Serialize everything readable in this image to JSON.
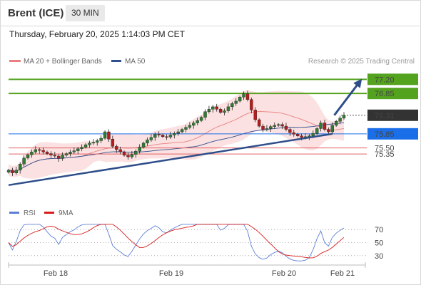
{
  "header": {
    "instrument": "Brent (ICE)",
    "timeframe": "30 MIN"
  },
  "datetime": "Thursday, February 20, 2025 1:14:03 PM CET",
  "colors": {
    "up": "#2e7d32",
    "down": "#b71c1c",
    "resistance": "#54a31f",
    "current": "#333333",
    "pivot": "#1a6ee8",
    "support": "#e06060",
    "band": "#f8c8c8",
    "ma20": "#e98080",
    "ma50": "#2f4f8f",
    "trend": "#2e4e8a",
    "rsi": "#5c7fd6",
    "rsi_ma": "#d91c1c"
  },
  "chart_data": [
    {
      "type": "candlestick",
      "title": "Brent (ICE)",
      "timeframe": "30 MIN",
      "legend": [
        {
          "name": "MA 20 + Bollinger Bands",
          "color": "#e98080"
        },
        {
          "name": "MA 50",
          "color": "#2f4f8f"
        }
      ],
      "source": "Research © 2025 Trading Central",
      "x_ticks": [
        "Feb 18",
        "Feb 19",
        "Feb 20",
        "Feb 21"
      ],
      "ylim": [
        74.4,
        77.4
      ],
      "levels": [
        {
          "value": 77.2,
          "label": "77.20",
          "kind": "resistance"
        },
        {
          "value": 76.85,
          "label": "76.85",
          "kind": "resistance"
        },
        {
          "value": 76.31,
          "label": "76.31",
          "kind": "current"
        },
        {
          "value": 75.85,
          "label": "75.85",
          "kind": "pivot"
        },
        {
          "value": 75.5,
          "label": "75.50",
          "kind": "support"
        },
        {
          "value": 75.35,
          "label": "75.35",
          "kind": "support"
        }
      ],
      "trendline": {
        "from": [
          0,
          74.58
        ],
        "to": [
          84,
          75.85
        ]
      },
      "forecast_arrow": {
        "from": [
          84.5,
          76.31
        ],
        "to": [
          91,
          77.13
        ]
      },
      "closes": [
        74.95,
        74.88,
        74.95,
        75.1,
        75.25,
        75.33,
        75.4,
        75.46,
        75.44,
        75.4,
        75.36,
        75.32,
        75.3,
        75.24,
        75.32,
        75.36,
        75.4,
        75.43,
        75.48,
        75.52,
        75.58,
        75.62,
        75.64,
        75.68,
        75.74,
        75.9,
        75.72,
        75.54,
        75.46,
        75.4,
        75.32,
        75.28,
        75.34,
        75.42,
        75.52,
        75.62,
        75.7,
        75.76,
        75.84,
        75.82,
        75.78,
        75.77,
        75.82,
        75.86,
        75.9,
        75.96,
        76.01,
        76.06,
        76.12,
        76.18,
        76.26,
        76.4,
        76.46,
        76.52,
        76.46,
        76.38,
        76.42,
        76.52,
        76.6,
        76.66,
        76.76,
        76.84,
        76.7,
        76.44,
        76.2,
        76.04,
        75.96,
        75.98,
        76.03,
        76.06,
        76.08,
        76.04,
        75.96,
        75.88,
        75.84,
        75.8,
        75.76,
        75.78,
        75.8,
        75.86,
        75.98,
        76.12,
        75.96,
        75.9,
        76.06,
        76.16,
        76.24,
        76.31
      ],
      "rsi_panel": {
        "legend": [
          {
            "name": "RSI",
            "color": "#5c7fd6"
          },
          {
            "name": "9MA",
            "color": "#d91c1c"
          }
        ],
        "ylim": [
          20,
          80
        ],
        "ticks": [
          70,
          50,
          30
        ]
      }
    }
  ]
}
